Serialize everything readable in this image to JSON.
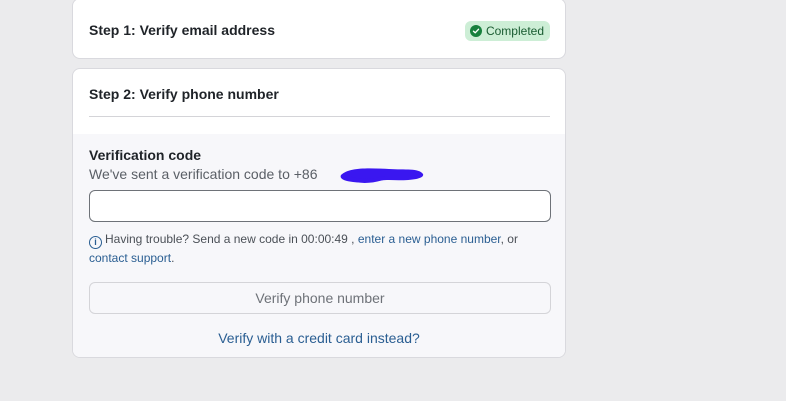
{
  "step1": {
    "title": "Step 1: Verify email address",
    "status": "Completed"
  },
  "step2": {
    "title": "Step 2: Verify phone number",
    "code_label": "Verification code",
    "sent_message": "We've sent a verification code to +86",
    "code_value": "",
    "help_text_1": "Having trouble? Send a new code in 00:00:49 ,",
    "change_number_link": "enter a new phone number",
    "help_text_2": ", or",
    "contact_support_link": "contact support",
    "help_text_3": ".",
    "verify_button": "Verify phone number",
    "credit_card_link": "Verify with a credit card instead?"
  },
  "colors": {
    "accent_link": "#2a5e92",
    "success_badge_bg": "#cdeed6",
    "success_badge_text": "#1a5c32",
    "redaction": "#3a17f0"
  },
  "icons": {
    "status": "check-circle-icon",
    "help": "info-icon"
  }
}
